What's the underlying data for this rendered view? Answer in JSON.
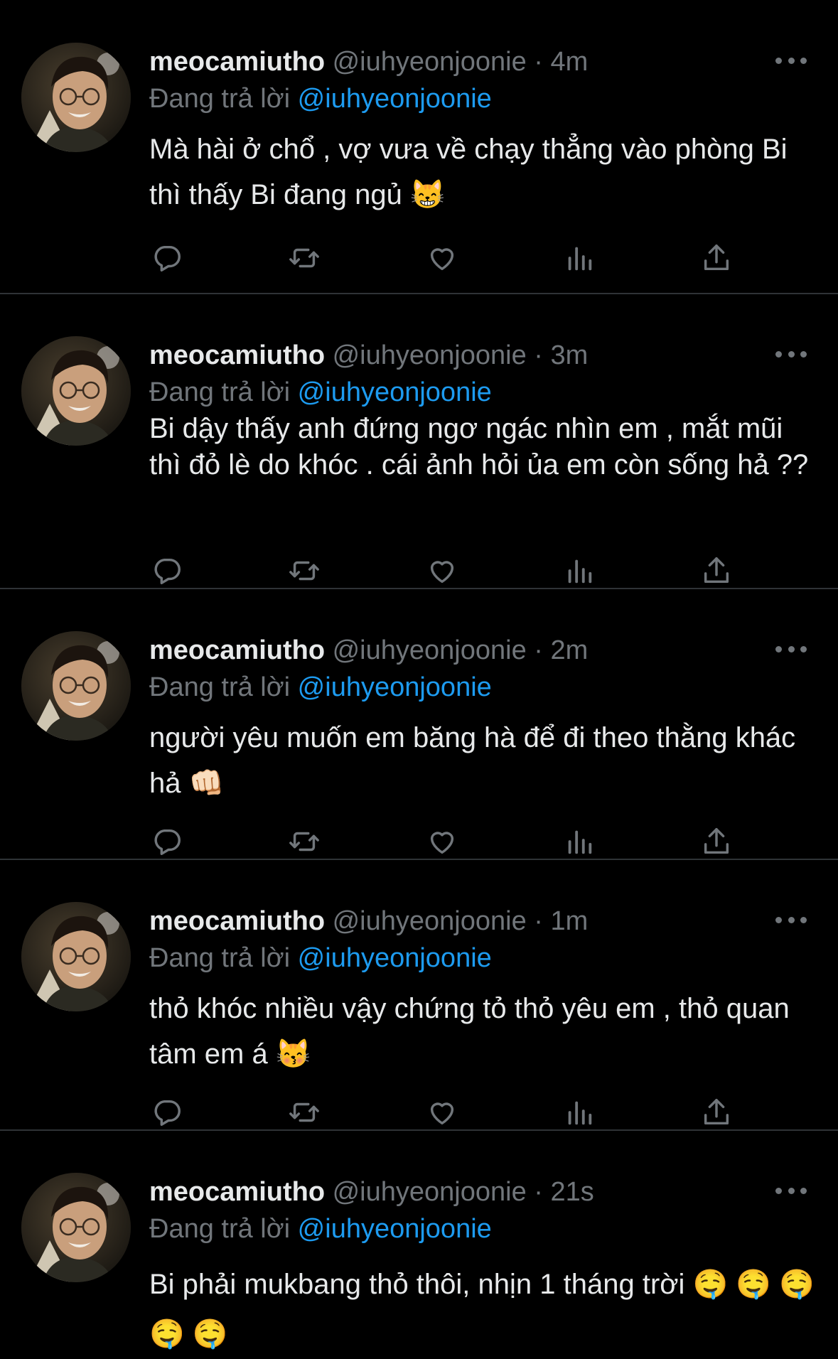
{
  "tweets": [
    {
      "name": "meocamiutho",
      "handle": "@iuhyeonjoonie",
      "dot": "·",
      "time": "4m",
      "reply_prefix": "Đang trả lời",
      "reply_to": "@iuhyeonjoonie",
      "text": "Mà hài ở chổ , vợ vưa về chạy thẳng vào phòng Bi thì thấy Bi đang ngủ 😸"
    },
    {
      "name": "meocamiutho",
      "handle": "@iuhyeonjoonie",
      "dot": "·",
      "time": "3m",
      "reply_prefix": "Đang trả lời",
      "reply_to": "@iuhyeonjoonie",
      "text": "Bi dậy thấy anh đứng ngơ ngác nhìn em , mắt mũi thì đỏ lè do khóc . cái ảnh hỏi ủa em còn sống hả ??"
    },
    {
      "name": "meocamiutho",
      "handle": "@iuhyeonjoonie",
      "dot": "·",
      "time": "2m",
      "reply_prefix": "Đang trả lời",
      "reply_to": "@iuhyeonjoonie",
      "text": "người yêu muốn em băng hà để đi theo thằng khác hả 👊🏻"
    },
    {
      "name": "meocamiutho",
      "handle": "@iuhyeonjoonie",
      "dot": "·",
      "time": "1m",
      "reply_prefix": "Đang trả lời",
      "reply_to": "@iuhyeonjoonie",
      "text": "thỏ khóc nhiều vậy chứng tỏ thỏ yêu em , thỏ quan tâm em á 😽"
    },
    {
      "name": "meocamiutho",
      "handle": "@iuhyeonjoonie",
      "dot": "·",
      "time": "21s",
      "reply_prefix": "Đang trả lời",
      "reply_to": "@iuhyeonjoonie",
      "text": "Bi phải mukbang thỏ thôi, nhịn 1 tháng trời 🤤 🤤 🤤 🤤 🤤"
    }
  ],
  "colors": {
    "background": "#000000",
    "text": "#e7e9ea",
    "secondary": "#71767b",
    "mention": "#1d9bf0",
    "divider": "#2f3336"
  },
  "icons": [
    "more-icon",
    "reply-icon",
    "retweet-icon",
    "like-icon",
    "views-icon",
    "share-icon"
  ]
}
